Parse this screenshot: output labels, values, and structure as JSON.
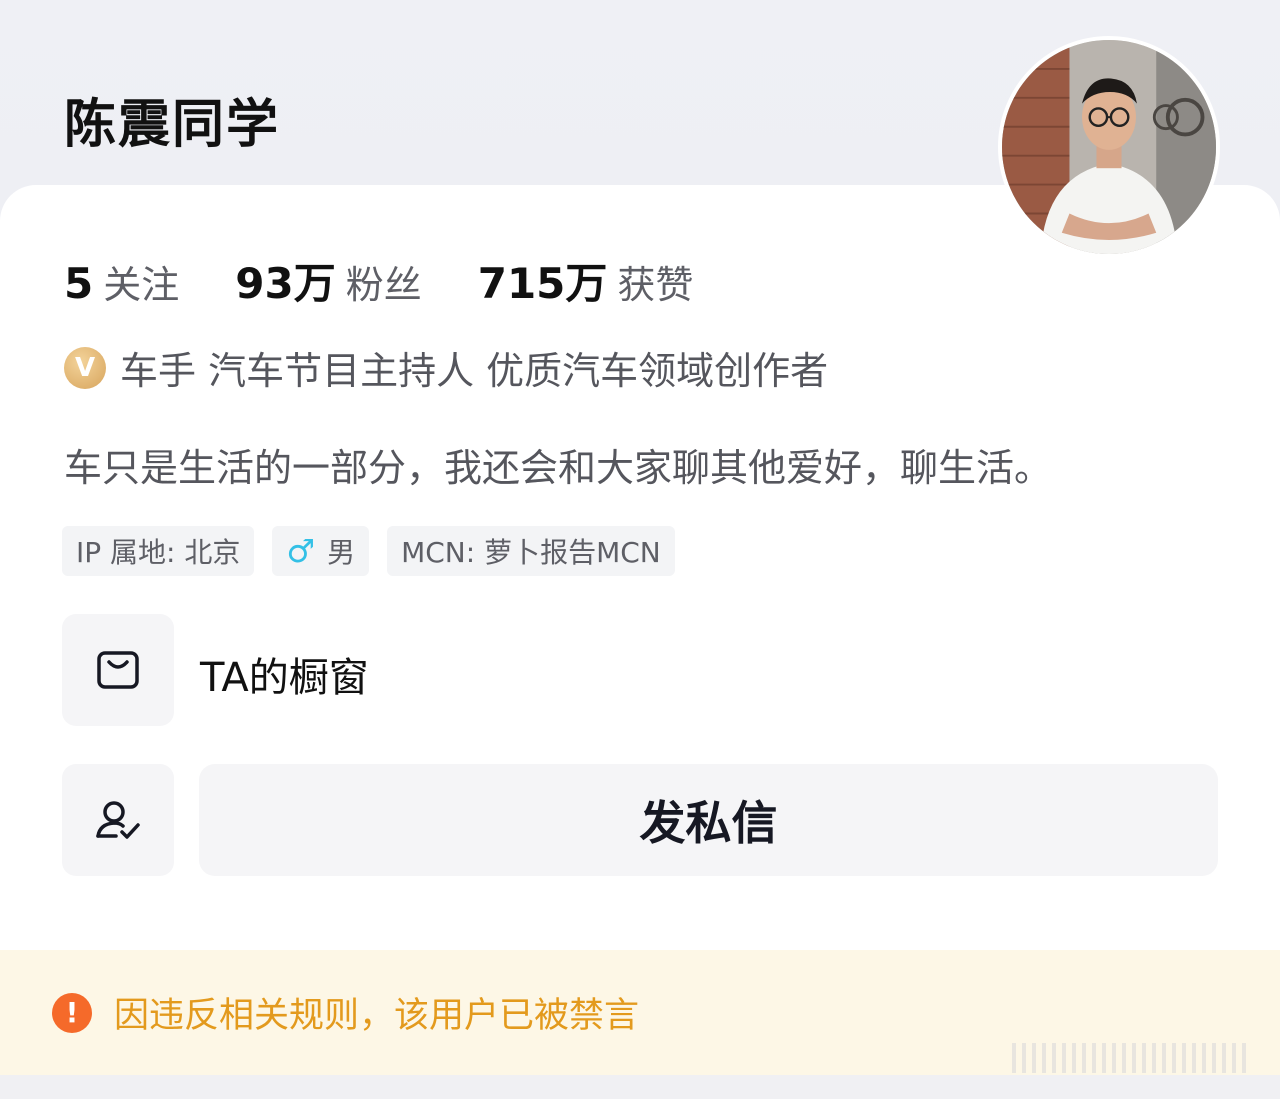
{
  "profile": {
    "username": "陈震同学",
    "stats": [
      {
        "num": "5",
        "label": "关注"
      },
      {
        "num": "93万",
        "label": "粉丝"
      },
      {
        "num": "715万",
        "label": "获赞"
      }
    ],
    "verify_badge": "V",
    "verify_text": "车手 汽车节目主持人 优质汽车领域创作者",
    "bio": "车只是生活的一部分，我还会和大家聊其他爱好，聊生活。",
    "tags": {
      "ip": "IP 属地: 北京",
      "gender_icon": "male-icon",
      "gender": "男",
      "mcn": "MCN: 萝卜报告MCN"
    }
  },
  "actions": {
    "shop_icon": "shopping-bag-icon",
    "shop_label": "TA的橱窗",
    "follow_icon": "user-check-icon",
    "message_label": "发私信"
  },
  "notice": {
    "icon": "exclamation-icon",
    "text": "因违反相关规则，该用户已被禁言"
  },
  "colors": {
    "accent_warning": "#f56a2a",
    "notice_text": "#e39a1d",
    "notice_bg": "#fdf7e6",
    "verify_gold": "#d7a45c",
    "male_blue": "#33c0e6"
  }
}
